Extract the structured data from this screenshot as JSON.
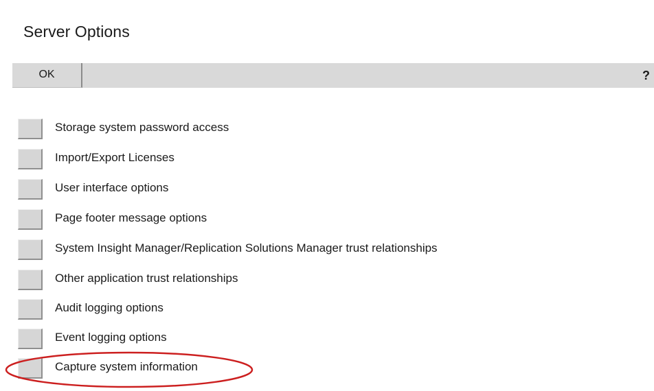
{
  "page": {
    "title": "Server Options"
  },
  "toolbar": {
    "ok_label": "OK",
    "help_label": "?"
  },
  "options": [
    {
      "label": "Storage system password access"
    },
    {
      "label": "Import/Export Licenses"
    },
    {
      "label": "User interface options"
    },
    {
      "label": "Page footer message options"
    },
    {
      "label": "System Insight Manager/Replication Solutions Manager trust relationships"
    },
    {
      "label": "Other application trust relationships"
    },
    {
      "label": "Audit logging options"
    },
    {
      "label": "Event logging options"
    },
    {
      "label": "Capture system information"
    }
  ],
  "annotation": {
    "color": "#cc1f1f"
  }
}
